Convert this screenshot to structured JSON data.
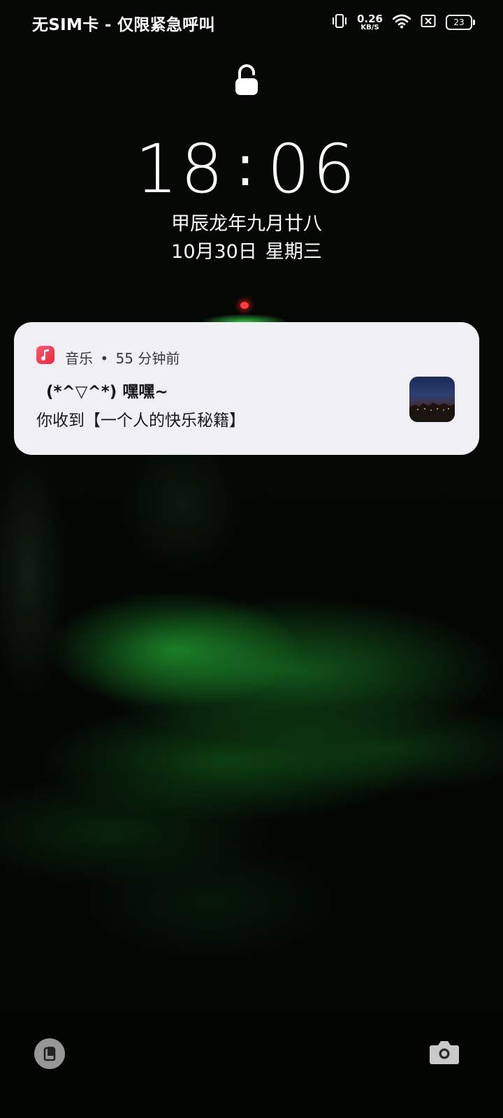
{
  "status_bar": {
    "carrier": "无SIM卡 - 仅限紧急呼叫",
    "net_speed_value": "0.26",
    "net_speed_unit": "KB/S",
    "battery_level": "23",
    "icons": [
      "vibrate-icon",
      "wifi-icon",
      "no-sim-icon",
      "battery-icon"
    ]
  },
  "lock_icon": "unlocked-padlock-icon",
  "clock": {
    "hour": "18",
    "separator": ":",
    "minute": "06"
  },
  "date": {
    "lunar": "甲辰龙年九月廿八",
    "solar": "10月30日",
    "weekday": "星期三"
  },
  "notification": {
    "app_name": "音乐",
    "separator": "•",
    "time_ago": "55 分钟前",
    "title": "(*^▽^*)   嘿嘿~",
    "body": "你收到【一个人的快乐秘籍】",
    "app_icon": "music-note-icon"
  },
  "bottom": {
    "left_icon": "wallet-icon",
    "right_icon": "camera-icon"
  },
  "colors": {
    "card_bg": "#f0f0f4",
    "music_icon": "#e8243e",
    "text": "#ffffff"
  }
}
